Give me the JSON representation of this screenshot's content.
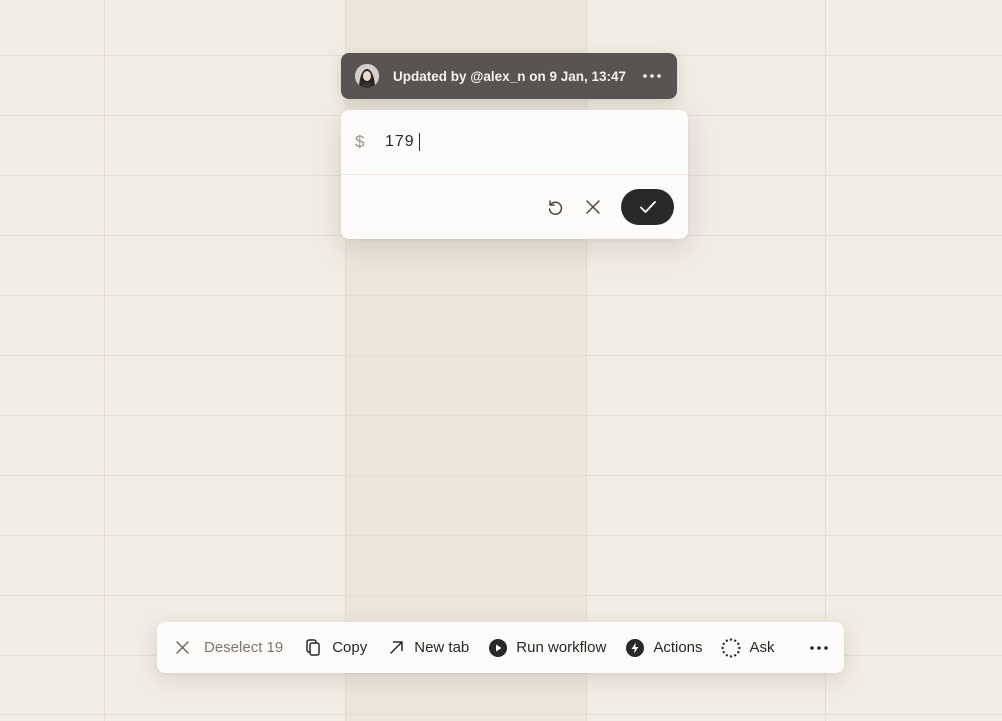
{
  "update_bar": {
    "text": "Updated by @alex_n on 9 Jan, 13:47",
    "avatar_icon": "user-avatar",
    "more_icon": "more-horizontal-icon"
  },
  "editor": {
    "currency_symbol": "$",
    "value": "179",
    "undo_icon": "undo-icon",
    "cancel_icon": "close-icon",
    "confirm_icon": "check-icon"
  },
  "toolbar": {
    "deselect_label": "Deselect 19",
    "copy_label": "Copy",
    "new_tab_label": "New tab",
    "run_workflow_label": "Run workflow",
    "actions_label": "Actions",
    "ask_label": "Ask"
  },
  "colors": {
    "background": "#f1ece4",
    "update_bar": "#575451",
    "confirm_button": "#2b2927"
  }
}
